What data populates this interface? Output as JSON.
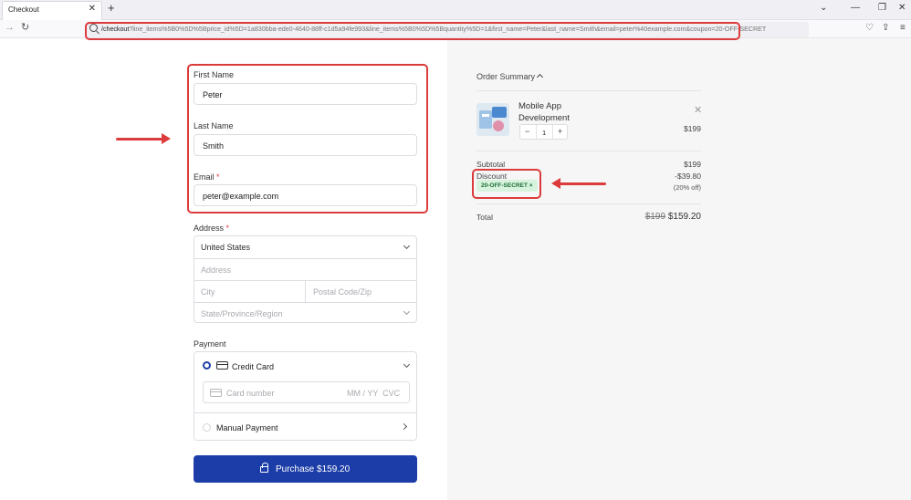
{
  "browser": {
    "tab_title": "Checkout",
    "tab_close": "✕",
    "new_tab": "+",
    "url_path": "/checkout",
    "url_query": "?line_items%5B0%5D%5Bprice_id%5D=1a830bba-ede0-4640-88ff-c1d5a94fe993&line_items%5B0%5D%5Bquantity%5D=1&first_name=Peter&last_name=Smith&email=peter%40example.com&coupon=20-OFF-SECRET"
  },
  "form": {
    "first_name": {
      "label": "First Name",
      "value": "Peter"
    },
    "last_name": {
      "label": "Last Name",
      "value": "Smith"
    },
    "email": {
      "label": "Email",
      "required_mark": "*",
      "value": "peter@example.com"
    },
    "address": {
      "label": "Address",
      "required_mark": "*",
      "country": "United States",
      "address_placeholder": "Address",
      "city_placeholder": "City",
      "postal_placeholder": "Postal Code/Zip",
      "state_placeholder": "State/Province/Region"
    },
    "payment": {
      "label": "Payment",
      "credit_card_label": "Credit Card",
      "card_number_placeholder": "Card number",
      "expiry_cvc_placeholder": "MM / YY  CVC",
      "manual_payment_label": "Manual Payment"
    },
    "purchase_button": "Purchase $159.20"
  },
  "summary": {
    "title": "Order Summary",
    "product": {
      "name": "Mobile App Development",
      "price": "$199",
      "quantity": "1",
      "minus": "−",
      "plus": "+"
    },
    "subtotal_label": "Subtotal",
    "subtotal_value": "$199",
    "discount_label": "Discount",
    "discount_value": "-$39.80",
    "discount_percent": "(20% off)",
    "coupon_code": "20-OFF-SECRET ×",
    "total_label": "Total",
    "total_original": "$199",
    "total_value": "$159.20"
  },
  "colors": {
    "primary_button": "#1c3da8",
    "annotation": "#dc3b3b",
    "coupon_bg": "#d7f3de",
    "coupon_text": "#1d6b36"
  }
}
